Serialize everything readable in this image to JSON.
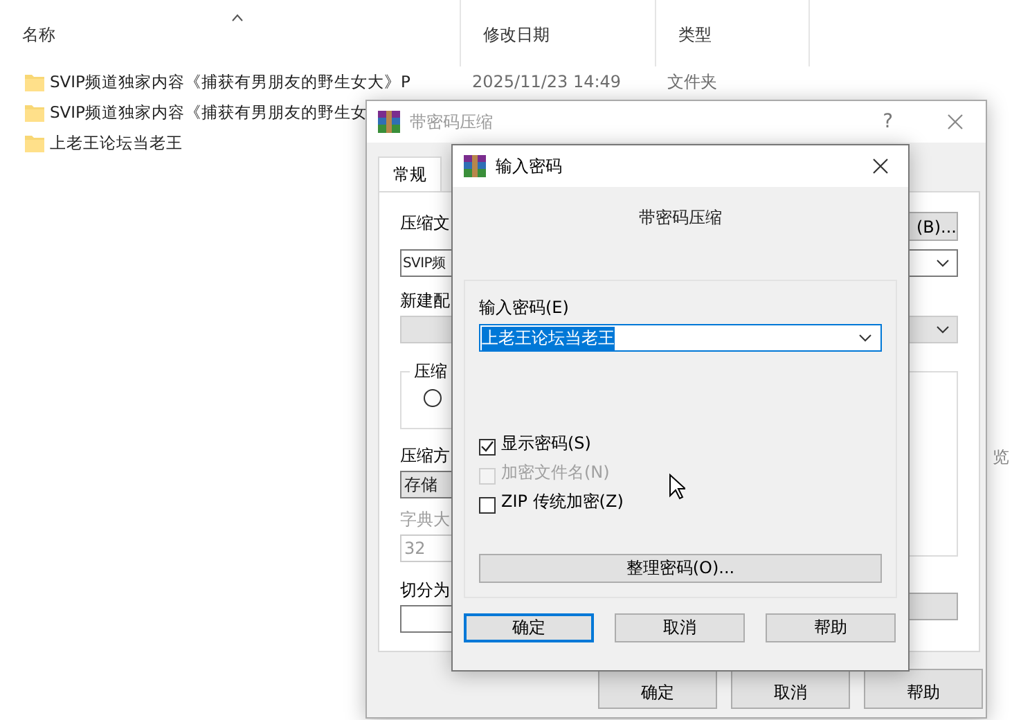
{
  "explorer": {
    "columns": [
      {
        "label": "名称"
      },
      {
        "label": "修改日期"
      },
      {
        "label": "类型"
      }
    ],
    "rows": [
      {
        "name": "SVIP频道独家内容《捕获有男朋友的野生女大》P",
        "date": "2025/11/23 14:49",
        "type": "文件夹"
      },
      {
        "name": "SVIP频道独家内容《捕获有男朋友的野生女"
      },
      {
        "name": "上老王论坛当老王"
      }
    ],
    "side_text": "览"
  },
  "compress_dialog": {
    "title": "带密码压缩",
    "help": "?",
    "tabs": [
      {
        "label": "常规",
        "selected": true
      }
    ],
    "archive_label": "压缩文",
    "browse_button": "(B)...",
    "archive_value": "SVIP频",
    "profile_label": "新建配",
    "group_title": "压缩",
    "radio": {
      "selected": false
    },
    "method_label": "压缩方",
    "method_value": "存储",
    "dict_label": "字典大",
    "dict_value": "32",
    "split_label": "切分为",
    "buttons": [
      "确定",
      "取消",
      "帮助"
    ]
  },
  "password_dialog": {
    "title": "输入密码",
    "subtitle": "带密码压缩",
    "password_label": "输入密码(E)",
    "password_value": "上老王论坛当老王",
    "options": [
      {
        "label": "显示密码(S)",
        "checked": true,
        "disabled": false
      },
      {
        "label": "加密文件名(N)",
        "checked": false,
        "disabled": true
      },
      {
        "label": "ZIP 传统加密(Z)",
        "checked": false,
        "disabled": false
      }
    ],
    "organize_button": "整理密码(O)...",
    "buttons": [
      {
        "label": "确定",
        "default": true
      },
      {
        "label": "取消",
        "default": false
      },
      {
        "label": "帮助",
        "default": false
      }
    ]
  }
}
